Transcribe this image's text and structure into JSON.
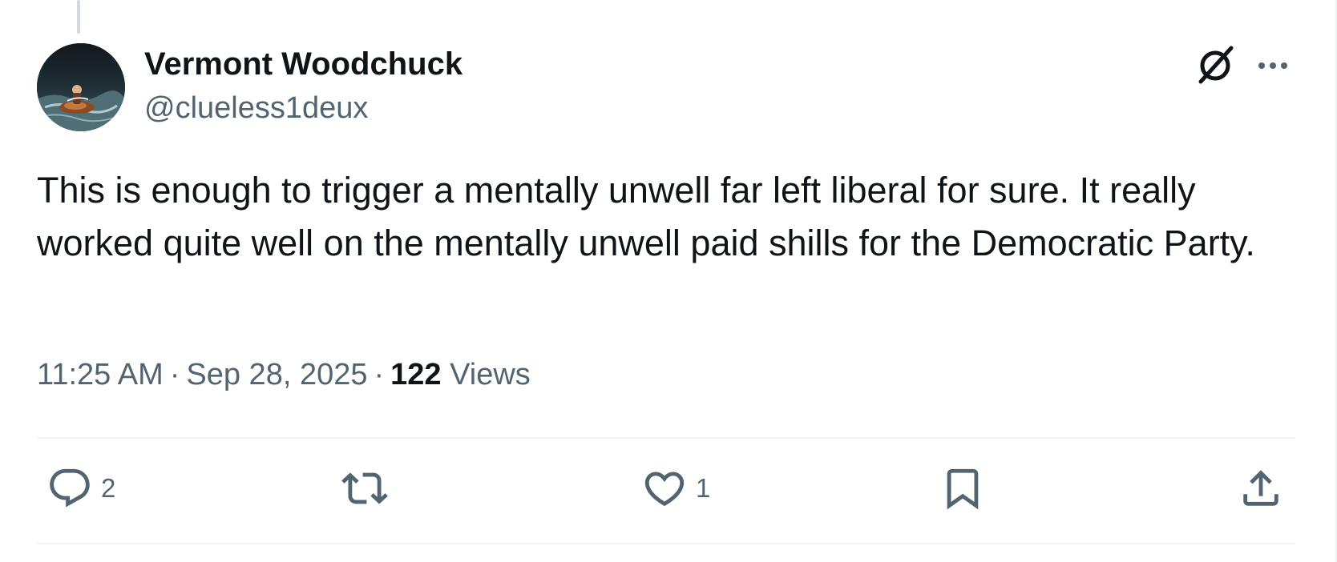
{
  "author": {
    "display_name": "Vermont Woodchuck",
    "handle": "@clueless1deux",
    "avatar_icon": "avatar-photo"
  },
  "header_actions": {
    "grok_icon": "grok-icon",
    "more_icon": "more-icon"
  },
  "tweet": {
    "text": "This is enough to trigger a mentally unwell far left liberal for sure. It really worked quite well on the mentally unwell paid shills for the Democratic Party."
  },
  "meta": {
    "time": "11:25 AM",
    "separator": "·",
    "date": "Sep 28, 2025",
    "views_count": "122",
    "views_label": "Views"
  },
  "actions": {
    "reply_count": "2",
    "retweet_count": "",
    "like_count": "1",
    "bookmark_icon": "bookmark-icon",
    "share_icon": "share-icon"
  },
  "colors": {
    "text_primary": "#0f1419",
    "text_secondary": "#536471",
    "divider": "#eff3f4",
    "thread_line": "#cfd9de"
  }
}
